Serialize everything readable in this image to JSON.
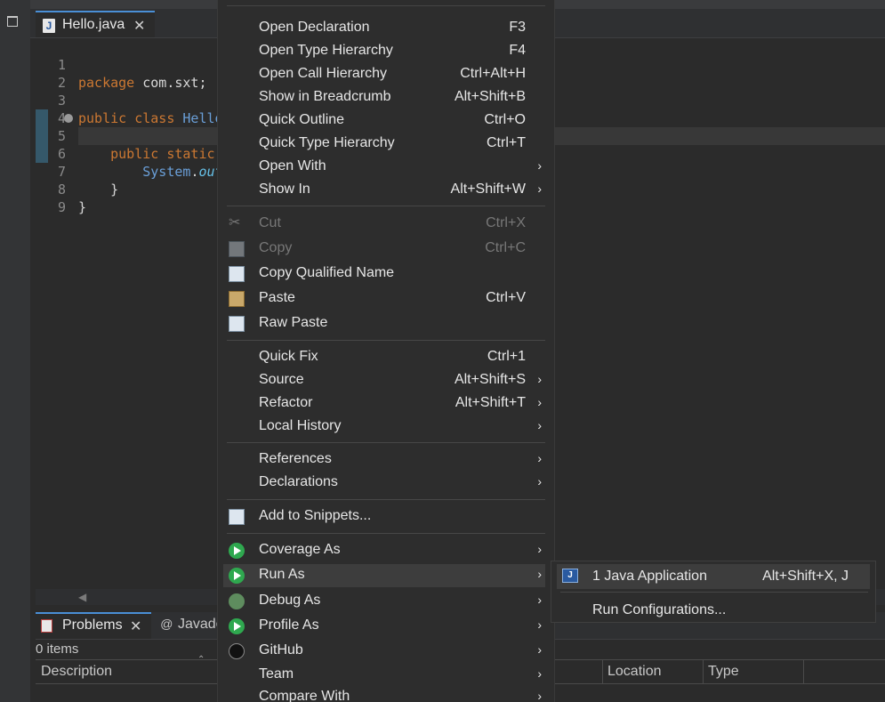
{
  "editor": {
    "tab_label": "Hello.java",
    "tab_icon": "J",
    "tab_close": "✕",
    "lines": [
      {
        "num": "1",
        "text": "package com.sxt;"
      },
      {
        "num": "2",
        "text": ""
      },
      {
        "num": "3",
        "text": "public class Hello"
      },
      {
        "num": "4",
        "text": ""
      },
      {
        "num": "5",
        "text": "    public static"
      },
      {
        "num": "6",
        "text": "        System.out"
      },
      {
        "num": "7",
        "text": "    }"
      },
      {
        "num": "8",
        "text": "}"
      },
      {
        "num": "9",
        "text": ""
      }
    ]
  },
  "bottom": {
    "problems_label": "Problems",
    "problems_close": "✕",
    "javadoc_label": "Javado",
    "items_count": "0 items",
    "columns": [
      "Description",
      "Location",
      "Type"
    ]
  },
  "context_menu": {
    "items": [
      {
        "label": "Open Declaration",
        "shortcut": "F3"
      },
      {
        "label": "Open Type Hierarchy",
        "shortcut": "F4"
      },
      {
        "label": "Open Call Hierarchy",
        "shortcut": "Ctrl+Alt+H"
      },
      {
        "label": "Show in Breadcrumb",
        "shortcut": "Alt+Shift+B"
      },
      {
        "label": "Quick Outline",
        "shortcut": "Ctrl+O"
      },
      {
        "label": "Quick Type Hierarchy",
        "shortcut": "Ctrl+T"
      },
      {
        "label": "Open With",
        "shortcut": ""
      },
      {
        "label": "Show In",
        "shortcut": "Alt+Shift+W"
      },
      {
        "label": "Cut",
        "shortcut": "Ctrl+X"
      },
      {
        "label": "Copy",
        "shortcut": "Ctrl+C"
      },
      {
        "label": "Copy Qualified Name",
        "shortcut": ""
      },
      {
        "label": "Paste",
        "shortcut": "Ctrl+V"
      },
      {
        "label": "Raw Paste",
        "shortcut": ""
      },
      {
        "label": "Quick Fix",
        "shortcut": "Ctrl+1"
      },
      {
        "label": "Source",
        "shortcut": "Alt+Shift+S"
      },
      {
        "label": "Refactor",
        "shortcut": "Alt+Shift+T"
      },
      {
        "label": "Local History",
        "shortcut": ""
      },
      {
        "label": "References",
        "shortcut": ""
      },
      {
        "label": "Declarations",
        "shortcut": ""
      },
      {
        "label": "Add to Snippets...",
        "shortcut": ""
      },
      {
        "label": "Coverage As",
        "shortcut": ""
      },
      {
        "label": "Run As",
        "shortcut": ""
      },
      {
        "label": "Debug As",
        "shortcut": ""
      },
      {
        "label": "Profile As",
        "shortcut": ""
      },
      {
        "label": "GitHub",
        "shortcut": ""
      },
      {
        "label": "Team",
        "shortcut": ""
      },
      {
        "label": "Compare With",
        "shortcut": ""
      }
    ],
    "submenu_arrow": "›"
  },
  "run_as_submenu": {
    "items": [
      {
        "label": "1 Java Application",
        "shortcut": "Alt+Shift+X, J"
      },
      {
        "label": "Run Configurations...",
        "shortcut": ""
      }
    ]
  },
  "colors": {
    "accent": "#4a8fd6",
    "menu_bg": "#2d2d2d",
    "menu_highlight": "#3d3d3d"
  }
}
